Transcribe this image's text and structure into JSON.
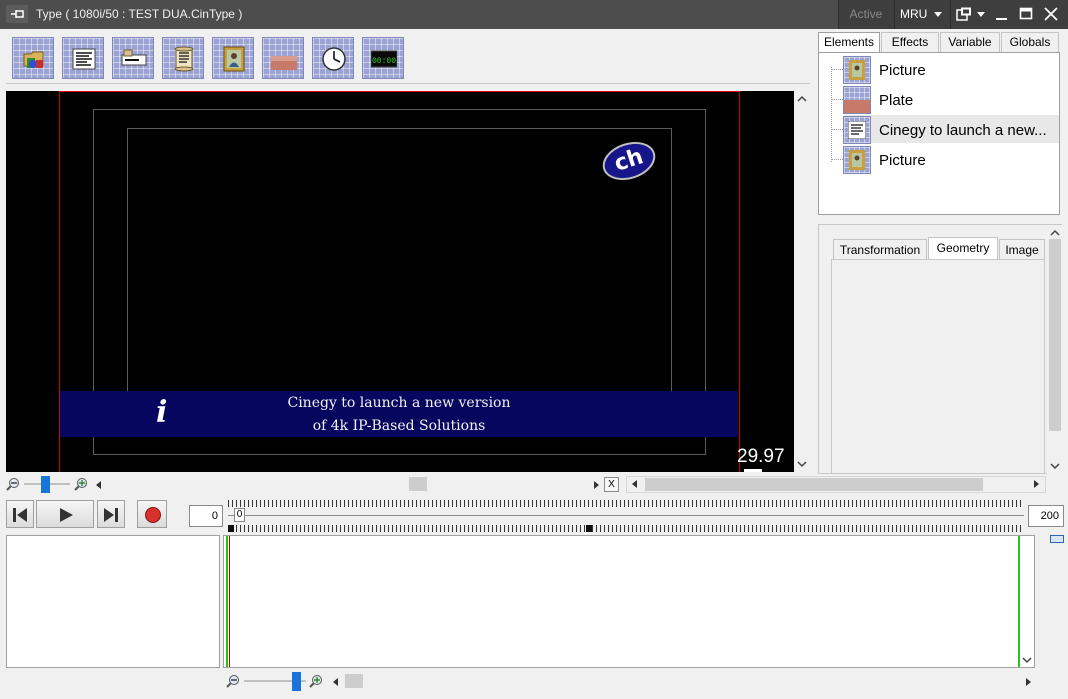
{
  "window": {
    "title": "Type ( 1080i/50 : TEST DUA.CinType )",
    "status": "Active",
    "mru_label": "MRU"
  },
  "toolbar": {
    "tools": [
      {
        "icon": "folder-open-icon"
      },
      {
        "icon": "text-block-icon"
      },
      {
        "icon": "ticker-icon"
      },
      {
        "icon": "scroll-icon"
      },
      {
        "icon": "picture-icon"
      },
      {
        "icon": "plate-icon"
      },
      {
        "icon": "clock-icon"
      },
      {
        "icon": "digital-clock-icon"
      }
    ],
    "digital_clock_text": "00:00"
  },
  "preview": {
    "line1": "Cinegy to launch a new version",
    "line2": "of 4k IP-Based Solutions",
    "info_glyph": "i",
    "logo_text": "ch",
    "fps": "29.97"
  },
  "right_panel": {
    "tabs": [
      "Elements",
      "Effects",
      "Variable",
      "Globals"
    ],
    "selected_tab": "Elements",
    "elements": [
      {
        "label": "Picture",
        "icon": "picture-icon"
      },
      {
        "label": "Plate",
        "icon": "plate-icon"
      },
      {
        "label": "Cinegy to launch a new...",
        "icon": "text-block-icon"
      },
      {
        "label": "Picture",
        "icon": "picture-icon"
      }
    ],
    "property_tabs": [
      "Transformation",
      "Geometry",
      "Image"
    ],
    "selected_property_tab": "Geometry"
  },
  "preview_zoom": {
    "close_label": "X"
  },
  "transport": {
    "start_value": "0",
    "end_value": "200",
    "cursor_label": "0"
  },
  "colors": {
    "banner": "#06065e",
    "safe_line": "#d40000",
    "timeline_marker": "#1ec81e"
  }
}
